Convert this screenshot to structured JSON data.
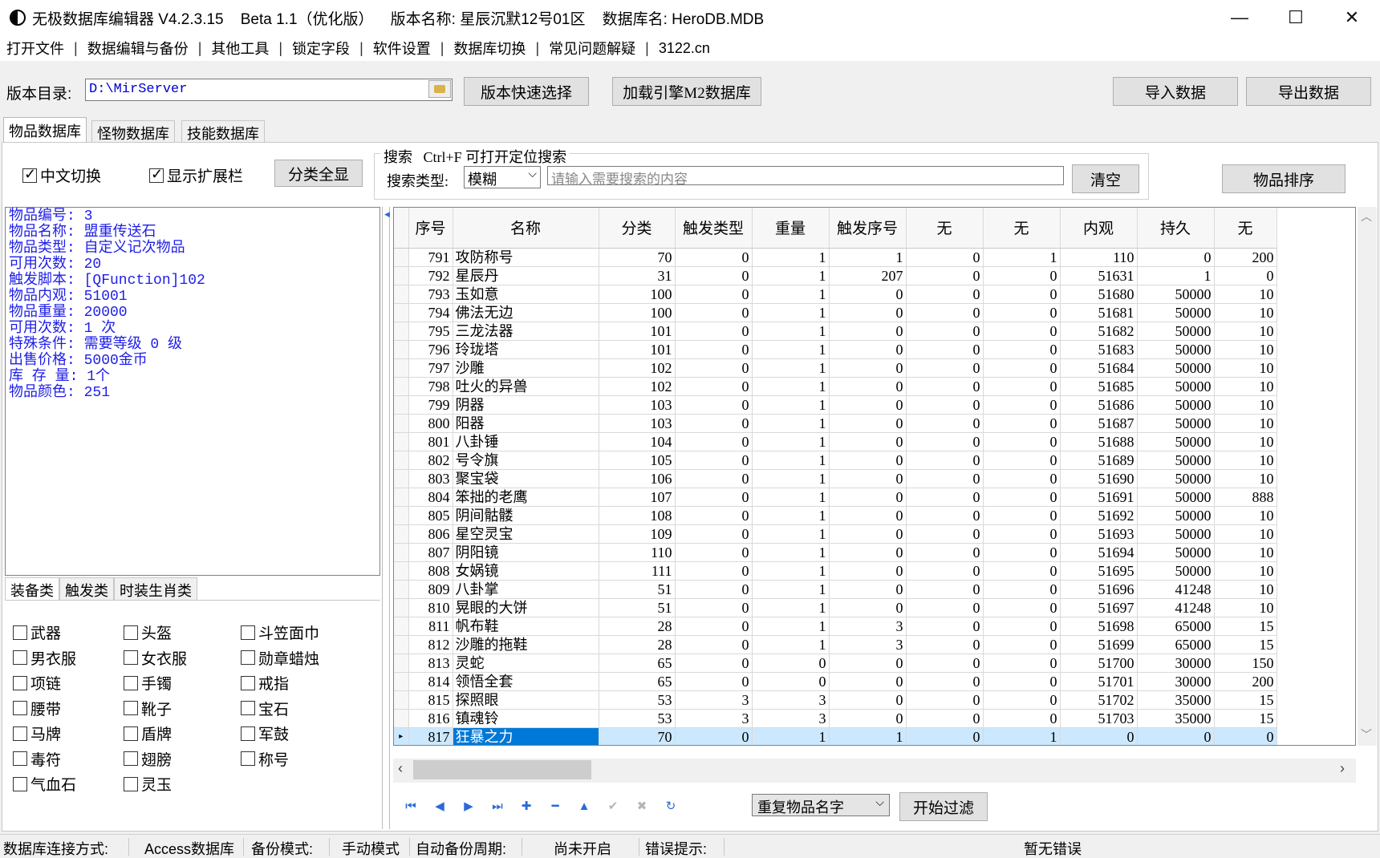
{
  "window": {
    "title": "无极数据库编辑器 V4.2.3.15    Beta 1.1（优化版）    版本名称: 星辰沉默12号01区    数据库名: HeroDB.MDB",
    "minimize": "—",
    "maximize": "☐",
    "close": "✕"
  },
  "menu": {
    "items": [
      "打开文件",
      "数据编辑与备份",
      "其他工具",
      "锁定字段",
      "软件设置",
      "数据库切换",
      "常见问题解疑",
      "3122.cn"
    ],
    "separator": "|"
  },
  "version": {
    "label": "版本目录:",
    "path": "D:\\MirServer",
    "quick_select": "版本快速选择",
    "load_m2": "加载引擎M2数据库",
    "import": "导入数据",
    "export": "导出数据"
  },
  "tabs": [
    "物品数据库",
    "怪物数据库",
    "技能数据库"
  ],
  "filters": {
    "chinese_switch": "中文切换",
    "show_ext": "显示扩展栏",
    "show_all": "分类全显",
    "search_title": "搜索   Ctrl+F 可打开定位搜索",
    "search_type_label": "搜索类型:",
    "search_type_value": "模糊",
    "search_placeholder": "请输入需要搜索的内容",
    "clear": "清空",
    "sort": "物品排序"
  },
  "info": [
    "物品编号: 3",
    "物品名称: 盟重传送石",
    "物品类型: 自定义记次物品",
    "可用次数: 20",
    "触发脚本: [QFunction]102",
    "物品内观: 51001",
    "物品重量: 20000",
    "可用次数: 1 次",
    "特殊条件: 需要等级 0 级",
    "出售价格: 5000金币",
    "库 存 量: 1个",
    "物品颜色: 251"
  ],
  "category_tabs": [
    "装备类",
    "触发类",
    "时装生肖类"
  ],
  "categories": [
    [
      "武器",
      "头盔",
      "斗笠面巾"
    ],
    [
      "男衣服",
      "女衣服",
      "勋章蜡烛"
    ],
    [
      "项链",
      "手镯",
      "戒指"
    ],
    [
      "腰带",
      "靴子",
      "宝石"
    ],
    [
      "马牌",
      "盾牌",
      "军鼓"
    ],
    [
      "毒符",
      "翅膀",
      "称号"
    ],
    [
      "气血石",
      "灵玉"
    ]
  ],
  "grid": {
    "columns": [
      "序号",
      "名称",
      "分类",
      "触发类型",
      "重量",
      "触发序号",
      "无",
      "无",
      "内观",
      "持久",
      "无"
    ],
    "rows": [
      [
        "791",
        "攻防称号",
        "70",
        "0",
        "1",
        "1",
        "0",
        "1",
        "110",
        "0",
        "200"
      ],
      [
        "792",
        "星辰丹",
        "31",
        "0",
        "1",
        "207",
        "0",
        "0",
        "51631",
        "1",
        "0"
      ],
      [
        "793",
        "玉如意",
        "100",
        "0",
        "1",
        "0",
        "0",
        "0",
        "51680",
        "50000",
        "10"
      ],
      [
        "794",
        "佛法无边",
        "100",
        "0",
        "1",
        "0",
        "0",
        "0",
        "51681",
        "50000",
        "10"
      ],
      [
        "795",
        "三龙法器",
        "101",
        "0",
        "1",
        "0",
        "0",
        "0",
        "51682",
        "50000",
        "10"
      ],
      [
        "796",
        "玲珑塔",
        "101",
        "0",
        "1",
        "0",
        "0",
        "0",
        "51683",
        "50000",
        "10"
      ],
      [
        "797",
        "沙雕",
        "102",
        "0",
        "1",
        "0",
        "0",
        "0",
        "51684",
        "50000",
        "10"
      ],
      [
        "798",
        "吐火的异兽",
        "102",
        "0",
        "1",
        "0",
        "0",
        "0",
        "51685",
        "50000",
        "10"
      ],
      [
        "799",
        "阴器",
        "103",
        "0",
        "1",
        "0",
        "0",
        "0",
        "51686",
        "50000",
        "10"
      ],
      [
        "800",
        "阳器",
        "103",
        "0",
        "1",
        "0",
        "0",
        "0",
        "51687",
        "50000",
        "10"
      ],
      [
        "801",
        "八卦锤",
        "104",
        "0",
        "1",
        "0",
        "0",
        "0",
        "51688",
        "50000",
        "10"
      ],
      [
        "802",
        "号令旗",
        "105",
        "0",
        "1",
        "0",
        "0",
        "0",
        "51689",
        "50000",
        "10"
      ],
      [
        "803",
        "聚宝袋",
        "106",
        "0",
        "1",
        "0",
        "0",
        "0",
        "51690",
        "50000",
        "10"
      ],
      [
        "804",
        "笨拙的老鹰",
        "107",
        "0",
        "1",
        "0",
        "0",
        "0",
        "51691",
        "50000",
        "888"
      ],
      [
        "805",
        "阴间骷髅",
        "108",
        "0",
        "1",
        "0",
        "0",
        "0",
        "51692",
        "50000",
        "10"
      ],
      [
        "806",
        "星空灵宝",
        "109",
        "0",
        "1",
        "0",
        "0",
        "0",
        "51693",
        "50000",
        "10"
      ],
      [
        "807",
        "阴阳镜",
        "110",
        "0",
        "1",
        "0",
        "0",
        "0",
        "51694",
        "50000",
        "10"
      ],
      [
        "808",
        "女娲镜",
        "111",
        "0",
        "1",
        "0",
        "0",
        "0",
        "51695",
        "50000",
        "10"
      ],
      [
        "809",
        "八卦掌",
        "51",
        "0",
        "1",
        "0",
        "0",
        "0",
        "51696",
        "41248",
        "10"
      ],
      [
        "810",
        "晃眼的大饼",
        "51",
        "0",
        "1",
        "0",
        "0",
        "0",
        "51697",
        "41248",
        "10"
      ],
      [
        "811",
        "帆布鞋",
        "28",
        "0",
        "1",
        "3",
        "0",
        "0",
        "51698",
        "65000",
        "15"
      ],
      [
        "812",
        "沙雕的拖鞋",
        "28",
        "0",
        "1",
        "3",
        "0",
        "0",
        "51699",
        "65000",
        "15"
      ],
      [
        "813",
        "灵蛇",
        "65",
        "0",
        "0",
        "0",
        "0",
        "0",
        "51700",
        "30000",
        "150"
      ],
      [
        "814",
        "领悟全套",
        "65",
        "0",
        "0",
        "0",
        "0",
        "0",
        "51701",
        "30000",
        "200"
      ],
      [
        "815",
        "探照眼",
        "53",
        "3",
        "3",
        "0",
        "0",
        "0",
        "51702",
        "35000",
        "15"
      ],
      [
        "816",
        "镇魂铃",
        "53",
        "3",
        "3",
        "0",
        "0",
        "0",
        "51703",
        "35000",
        "15"
      ],
      [
        "817",
        "狂暴之力",
        "70",
        "0",
        "1",
        "1",
        "0",
        "1",
        "0",
        "0",
        "0"
      ]
    ],
    "selected_row": 26
  },
  "navigator": {
    "icons": [
      "nav-first-icon",
      "nav-prior-icon",
      "nav-next-icon",
      "nav-last-icon",
      "nav-insert-icon",
      "nav-delete-icon",
      "nav-edit-icon",
      "nav-post-icon",
      "nav-cancel-icon",
      "nav-refresh-icon"
    ],
    "glyphs": [
      "⏮",
      "◀",
      "▶",
      "⏭",
      "✚",
      "━",
      "▲",
      "✔",
      "✖",
      "↻"
    ]
  },
  "filter_bar": {
    "dup_select": "重复物品名字",
    "start_filter": "开始过滤"
  },
  "status": {
    "conn_label": "数据库连接方式:",
    "conn_value": "Access数据库",
    "backup_label": "备份模式:",
    "backup_value": "手动模式",
    "auto_label": "自动备份周期:",
    "auto_value": "尚未开启",
    "error_label": "错误提示:",
    "error_value": "暂无错误"
  },
  "colors": {
    "info_text": "#1e1ee8",
    "selection": "#0078d7",
    "selection_row": "#cce8ff",
    "nav_icon": "#2a6ad8"
  }
}
